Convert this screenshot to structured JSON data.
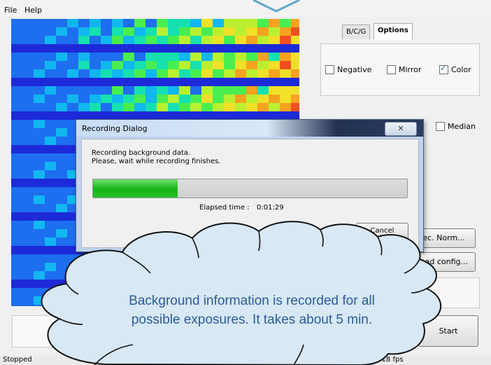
{
  "menu": {
    "file": "File",
    "help": "Help"
  },
  "colors": {
    "callout_fill": "#d8e8f4",
    "callout_stroke": "#111111",
    "callout_text": "#2a5b9c",
    "progress": "#15b515"
  },
  "options": {
    "tabs": [
      {
        "label": "B/C/G",
        "active": false
      },
      {
        "label": "Options",
        "active": true
      }
    ],
    "negative": {
      "label": "Negative",
      "checked": false
    },
    "mirror": {
      "label": "Mirror",
      "checked": false
    },
    "color": {
      "label": "Color",
      "checked": true
    },
    "median": {
      "label": "Median",
      "checked": false
    }
  },
  "buttons": {
    "spec_norm": "ec. Norm...",
    "load_config": "Load config...",
    "start": "Start"
  },
  "dialog": {
    "title": "Recording Dialog",
    "close_icon": "close-icon",
    "line1": "Recording background data.",
    "line2": "Please, wait while recording finishes.",
    "progress_fraction": 0.27,
    "elapsed_label": "Elapsed time :",
    "elapsed_value": "0:01:29",
    "cancel": "Cancel"
  },
  "status": {
    "left": "Stopped",
    "right": "5.18 fps"
  },
  "callout": {
    "line1": "Background information is recorded for all",
    "line2": "possible exposures. It takes about 5 min."
  }
}
